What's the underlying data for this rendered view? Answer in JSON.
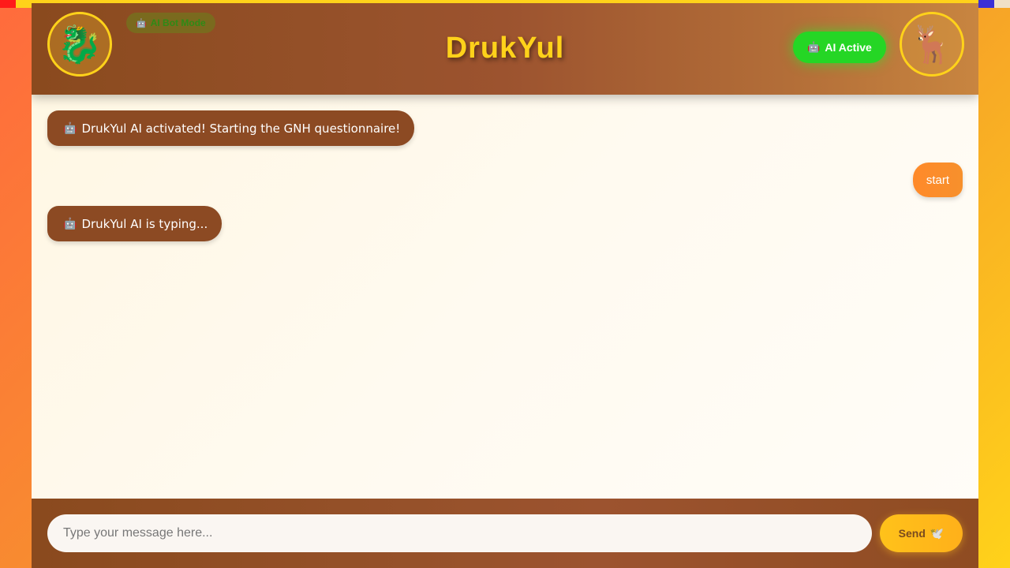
{
  "colors": {
    "accent_gold": "#ffd21a",
    "header_brown": "#96512a",
    "bot_bubble": "#8c4a23",
    "user_bubble": "#ff8a2a",
    "status_green": "#25d625",
    "send_button": "#ffc21a"
  },
  "header": {
    "title": "DrukYul",
    "mode_badge": {
      "icon": "robot-icon",
      "icon_glyph": "🤖",
      "label": "AI Bot Mode"
    },
    "status_badge": {
      "icon": "robot-icon",
      "icon_glyph": "🤖",
      "label": "AI Active"
    },
    "left_avatar": {
      "icon": "dragon-icon",
      "glyph": "🐉"
    },
    "right_avatar": {
      "icon": "takin-icon",
      "glyph": "🦌"
    }
  },
  "chat": {
    "messages": [
      {
        "sender": "bot",
        "icon": "robot-icon",
        "icon_glyph": "🤖",
        "text": "DrukYul AI activated! Starting the GNH questionnaire!"
      },
      {
        "sender": "user",
        "text": "start"
      },
      {
        "sender": "bot",
        "icon": "robot-icon",
        "icon_glyph": "🤖",
        "text": "DrukYul AI is typing..."
      }
    ]
  },
  "composer": {
    "placeholder": "Type your message here...",
    "value": "",
    "send_label": "Send",
    "send_icon": "send-icon",
    "send_icon_glyph": "🕊️"
  }
}
